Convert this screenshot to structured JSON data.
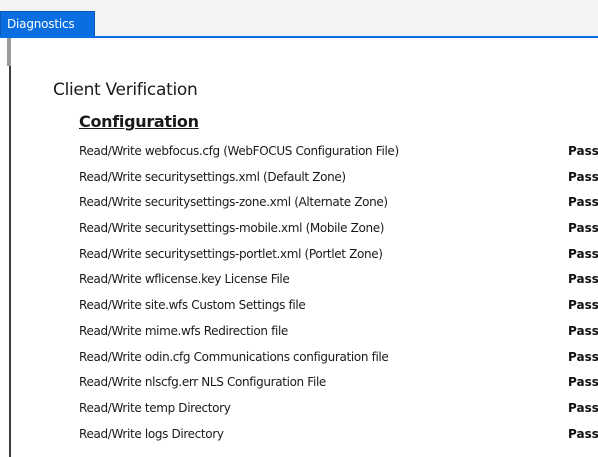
{
  "tabs": [
    {
      "label": "Diagnostics"
    }
  ],
  "page_title": "Client Verification",
  "section": {
    "heading": "Configuration",
    "checks": [
      {
        "label": "Read/Write webfocus.cfg (WebFOCUS Configuration File)",
        "status": "Pass"
      },
      {
        "label": "Read/Write securitysettings.xml (Default Zone)",
        "status": "Pass"
      },
      {
        "label": "Read/Write securitysettings-zone.xml (Alternate Zone)",
        "status": "Pass"
      },
      {
        "label": "Read/Write securitysettings-mobile.xml (Mobile Zone)",
        "status": "Pass"
      },
      {
        "label": "Read/Write securitysettings-portlet.xml (Portlet Zone)",
        "status": "Pass"
      },
      {
        "label": "Read/Write wflicense.key License File",
        "status": "Pass"
      },
      {
        "label": "Read/Write site.wfs Custom Settings file",
        "status": "Pass"
      },
      {
        "label": "Read/Write mime.wfs Redirection file",
        "status": "Pass"
      },
      {
        "label": "Read/Write odin.cfg Communications configuration file",
        "status": "Pass"
      },
      {
        "label": "Read/Write nlscfg.err NLS Configuration File",
        "status": "Pass"
      },
      {
        "label": "Read/Write temp Directory",
        "status": "Pass"
      },
      {
        "label": "Read/Write logs Directory",
        "status": "Pass"
      }
    ]
  },
  "colors": {
    "tab_active": "#0a6ee0",
    "text": "#1a1a1a"
  }
}
